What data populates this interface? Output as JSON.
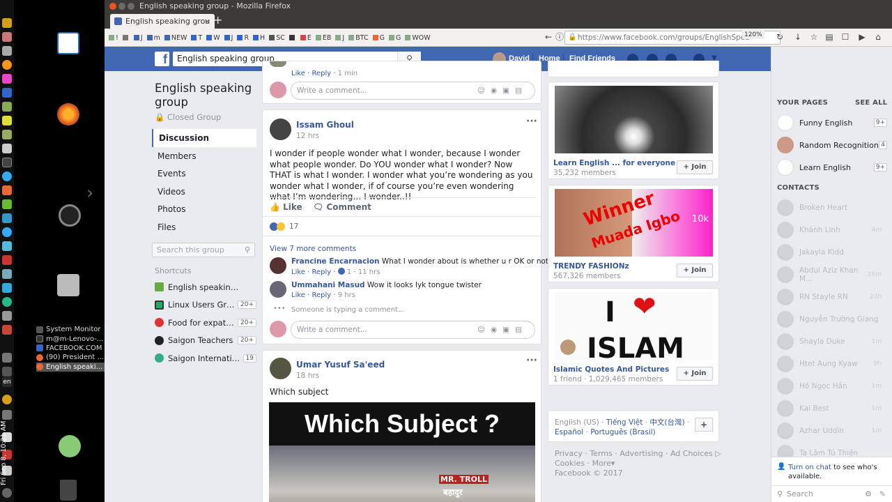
{
  "window": {
    "title": "English speaking group - Mozilla Firefox"
  },
  "tab": {
    "title": "English speaking grou",
    "close": "×",
    "new": "+"
  },
  "bookmarks": [
    "!",
    "",
    "J",
    "m",
    "NEW",
    "T",
    "W",
    "J",
    "R",
    "H",
    "SC",
    "",
    "E",
    "EB",
    "J",
    "BTC",
    "G",
    "G",
    "WOW"
  ],
  "url": {
    "value": "https://www.facebook.com/groups/EnglishSpea",
    "zoom": "120%"
  },
  "desktop": {
    "tasks": [
      "System Monitor",
      "m@m-Lenovo-...",
      "FACEBOOK.COM",
      "(90) President ...",
      "English speaki..."
    ],
    "lang": "en",
    "clock": "Fri Sep 8, 10:21 AM"
  },
  "fbbar": {
    "search_value": "English speaking group",
    "user": "David",
    "home": "Home",
    "find_friends": "Find Friends"
  },
  "group": {
    "title": "English speaking group",
    "type": "Closed Group"
  },
  "leftnav": [
    "Discussion",
    "Members",
    "Events",
    "Videos",
    "Photos",
    "Files"
  ],
  "left_search": "Search this group",
  "shortcuts": {
    "header": "Shortcuts",
    "items": [
      {
        "name": "English speaking group",
        "count": ""
      },
      {
        "name": "Linux Users Group",
        "count": "20+"
      },
      {
        "name": "Food for expats in ...",
        "count": "20+"
      },
      {
        "name": "Saigon Teachers",
        "count": "20+"
      },
      {
        "name": "Saigon International...",
        "count": "19"
      }
    ]
  },
  "feed": {
    "top_meta": {
      "like": "Like",
      "reply": "Reply",
      "time": "1 min"
    },
    "write_comment": "Write a comment...",
    "post1": {
      "author": "Issam Ghoul",
      "time": "12 hrs",
      "text": "I wonder if people wonder what I wonder, because I wonder what people wonder. Do YOU wonder what I wonder? Now THAT is what I wonder. I wonder what you’re wondering as you wonder what I wonder, if of course you’re even wondering what I’m wondering… I wonder..!!",
      "like": "Like",
      "comment": "Comment",
      "reactions": "17",
      "view_more": "View 7 more comments",
      "comments": [
        {
          "author": "Francine Encarnacion",
          "text": "What I wonder about is whether u r OK or not...",
          "like": "Like",
          "reply": "Reply",
          "reacts": "1",
          "time": "11 hrs"
        },
        {
          "author": "Ummahani Masud",
          "text": "Wow it looks lyk tongue twister",
          "like": "Like",
          "reply": "Reply",
          "time": "9 hrs"
        }
      ],
      "typing": "Someone is typing a comment..."
    },
    "post2": {
      "author": "Umar Yusuf Sa'eed",
      "time": "18 hrs",
      "text": "Which subject",
      "image_title": "Which  Subject  ?",
      "image_stamp": "MR. TROLL",
      "image_stamp2": "बहादुर"
    }
  },
  "suggested": [
    {
      "name": "Learn English ... for everyone",
      "members": "35,232 members",
      "join": "Join"
    },
    {
      "name": "TRENDY FASHIONz",
      "members": "567,326 members",
      "join": "Join",
      "overlay1": "Winner",
      "overlay2": "Muada Igbo",
      "badge": "10k"
    },
    {
      "name": "Islamic Quotes And Pictures",
      "members": "1 friend · 1,029,465 members",
      "join": "Join",
      "overlay1": "I",
      "overlay2": "ISLAM"
    }
  ],
  "languages": {
    "current": "English (US)",
    "others": [
      "Tiếng Việt",
      "中文(台灣)",
      "Español",
      "Português (Brasil)"
    ]
  },
  "footer": {
    "links": [
      "Privacy",
      "Terms",
      "Advertising",
      "Ad Choices",
      "Cookies",
      "More"
    ],
    "copyright": "Facebook © 2017"
  },
  "chat": {
    "your_pages": "YOUR PAGES",
    "see_all": "SEE ALL",
    "pages": [
      {
        "name": "Funny English",
        "count": "9+"
      },
      {
        "name": "Random Recognition",
        "count": "4"
      },
      {
        "name": "Learn English",
        "count": "9+"
      }
    ],
    "contacts_header": "CONTACTS",
    "contacts": [
      {
        "name": "Broken Heart",
        "time": ""
      },
      {
        "name": "Khánh Linh",
        "time": "4m"
      },
      {
        "name": "Jakayla Kidd",
        "time": ""
      },
      {
        "name": "Abdul Aziz Khan M...",
        "time": "16m"
      },
      {
        "name": "RN Stayle RN",
        "time": "23h"
      },
      {
        "name": "Nguyễn Trường Giang",
        "time": ""
      },
      {
        "name": "Shayla Duke",
        "time": "1m"
      },
      {
        "name": "Htet Aung Kyaw",
        "time": "9h"
      },
      {
        "name": "Hồ Ngọc Hân",
        "time": "1m"
      },
      {
        "name": "Kai Best",
        "time": "1m"
      },
      {
        "name": "Azhar Uddin",
        "time": "1m"
      },
      {
        "name": "Ta Lâm Tú Thiện",
        "time": ""
      }
    ],
    "turn_on": "Turn on chat",
    "turn_on_rest": " to see who's available.",
    "search": "Search"
  }
}
